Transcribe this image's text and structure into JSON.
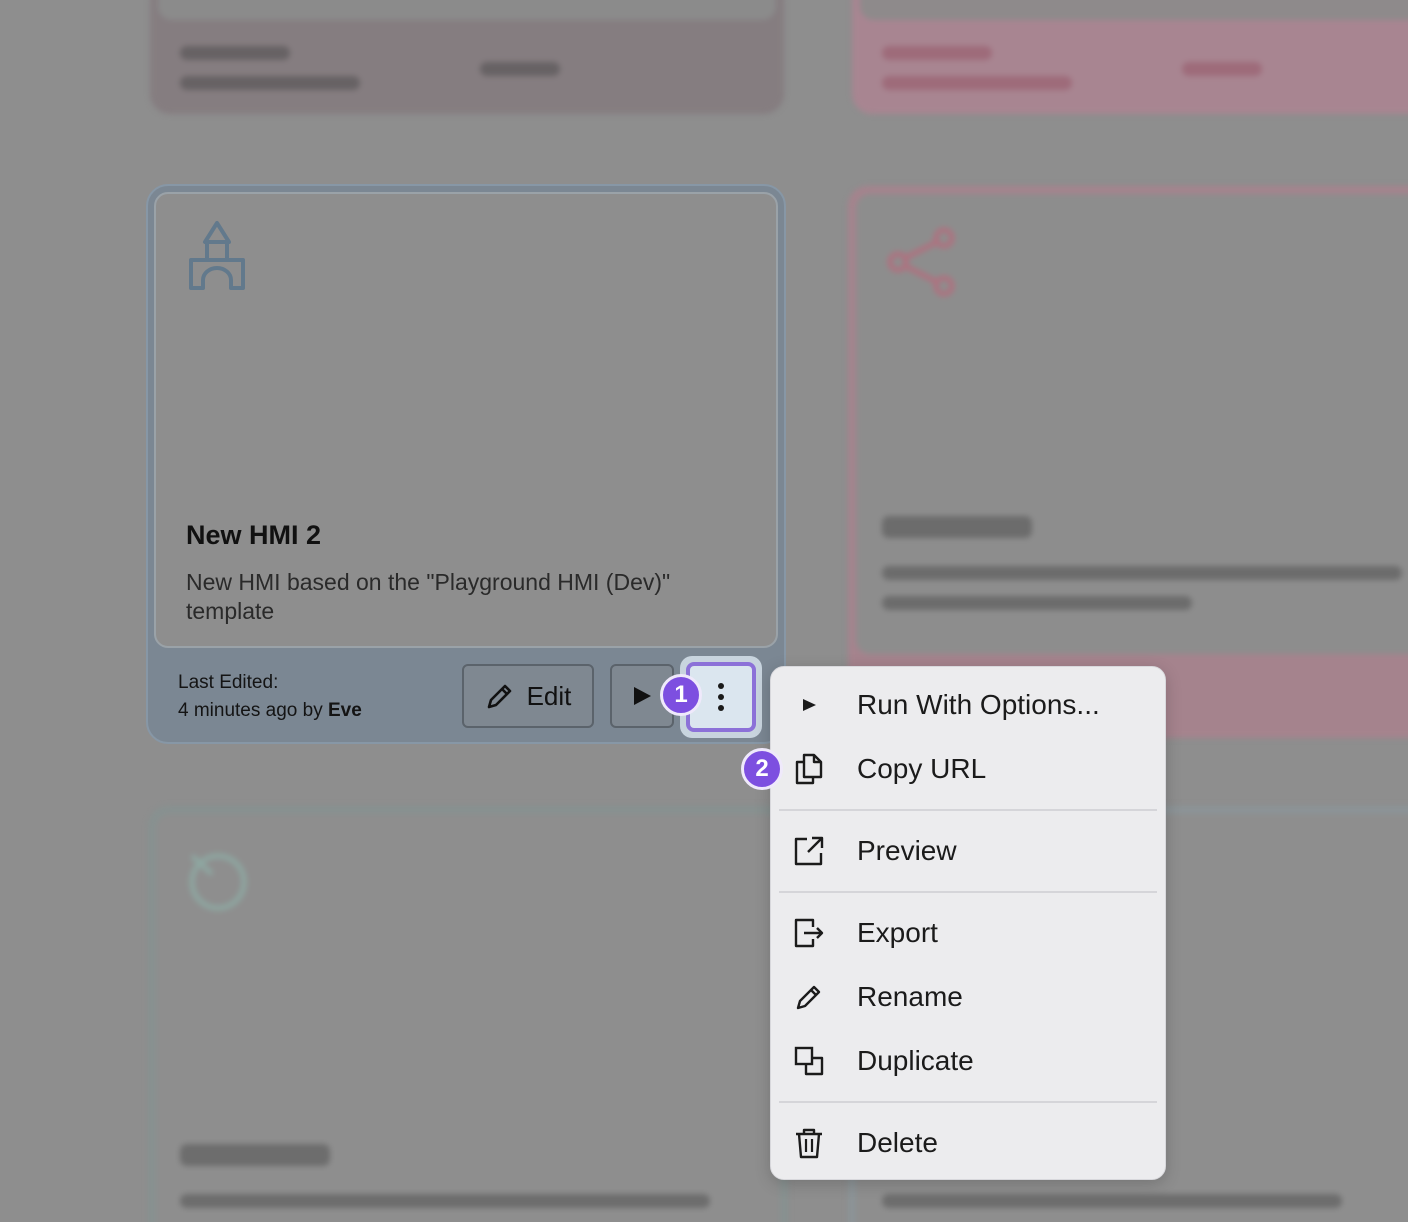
{
  "card": {
    "title": "New HMI 2",
    "description": "New HMI based on the \"Playground HMI (Dev)\" template",
    "last_edited_label": "Last Edited:",
    "last_edited_time": "4 minutes ago by",
    "last_edited_user": "Eve",
    "edit_label": "Edit"
  },
  "badges": {
    "step1": "1",
    "step2": "2"
  },
  "menu": {
    "run_with_options": "Run With Options...",
    "copy_url": "Copy URL",
    "preview": "Preview",
    "export": "Export",
    "rename": "Rename",
    "duplicate": "Duplicate",
    "delete": "Delete"
  },
  "colors": {
    "accent_purple": "#7d4fe0",
    "highlight_border": "#8c71d8",
    "overlay": "#8e8e8e"
  },
  "icons": [
    "castle-icon",
    "pencil-icon",
    "play-icon",
    "kebab-menu-icon",
    "copy-icon",
    "external-link-icon",
    "export-icon",
    "duplicate-icon",
    "trash-icon"
  ]
}
